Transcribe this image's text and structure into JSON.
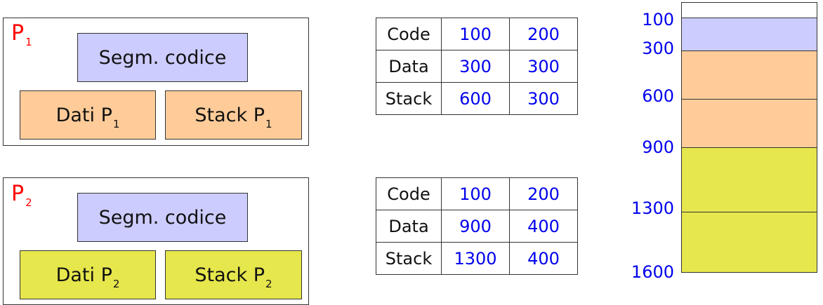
{
  "processes": [
    {
      "label": "P",
      "sub": "1",
      "code_label": "Segm. codice",
      "data_label": "Dati P",
      "data_sub": "1",
      "stack_label": "Stack P",
      "stack_sub": "1"
    },
    {
      "label": "P",
      "sub": "2",
      "code_label": "Segm. codice",
      "data_label": "Dati P",
      "data_sub": "2",
      "stack_label": "Stack P",
      "stack_sub": "2"
    }
  ],
  "segment_tables": [
    {
      "rows": [
        {
          "name": "Code",
          "base": "100",
          "limit": "200"
        },
        {
          "name": "Data",
          "base": "300",
          "limit": "300"
        },
        {
          "name": "Stack",
          "base": "600",
          "limit": "300"
        }
      ]
    },
    {
      "rows": [
        {
          "name": "Code",
          "base": "100",
          "limit": "200"
        },
        {
          "name": "Data",
          "base": "900",
          "limit": "400"
        },
        {
          "name": "Stack",
          "base": "1300",
          "limit": "400"
        }
      ]
    }
  ],
  "memory": {
    "addresses": [
      "100",
      "300",
      "600",
      "900",
      "1300",
      "1600"
    ],
    "colors": {
      "code": "#ccccff",
      "p1": "#ffcc99",
      "p2": "#e6e64d",
      "free": "#ffffff"
    }
  }
}
